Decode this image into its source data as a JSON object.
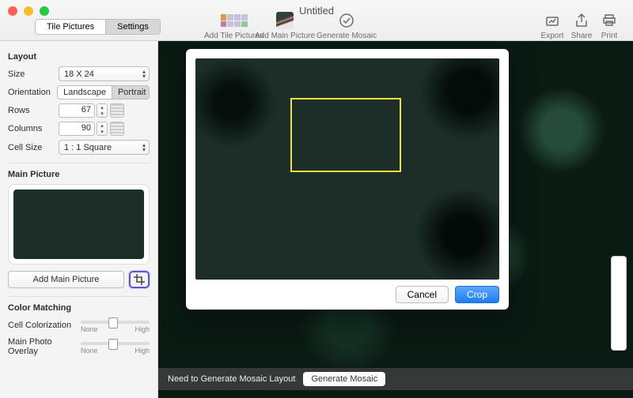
{
  "window": {
    "title": "Untitled"
  },
  "topSeg": {
    "tile": "Tile Pictures",
    "settings": "Settings"
  },
  "toolbar": {
    "addTile": "Add Tile Pictures",
    "addMain": "Add Main Picture",
    "generate": "Generate Mosaic",
    "export": "Export",
    "share": "Share",
    "print": "Print"
  },
  "layout": {
    "heading": "Layout",
    "sizeLabel": "Size",
    "sizeValue": "18 X 24",
    "orientLabel": "Orientation",
    "landscape": "Landscape",
    "portrait": "Portrait",
    "rowsLabel": "Rows",
    "rowsValue": "67",
    "colsLabel": "Columns",
    "colsValue": "90",
    "cellLabel": "Cell Size",
    "cellValue": "1 : 1 Square"
  },
  "mainPic": {
    "heading": "Main Picture",
    "addBtn": "Add Main Picture"
  },
  "colorMatch": {
    "heading": "Color Matching",
    "cellColor": "Cell Colorization",
    "mainOverlay": "Main Photo Overlay",
    "none": "None",
    "high": "High"
  },
  "statusbar": {
    "msg": "Need to Generate Mosaic Layout",
    "btn": "Generate Mosaic"
  },
  "cropDlg": {
    "cancel": "Cancel",
    "crop": "Crop"
  }
}
